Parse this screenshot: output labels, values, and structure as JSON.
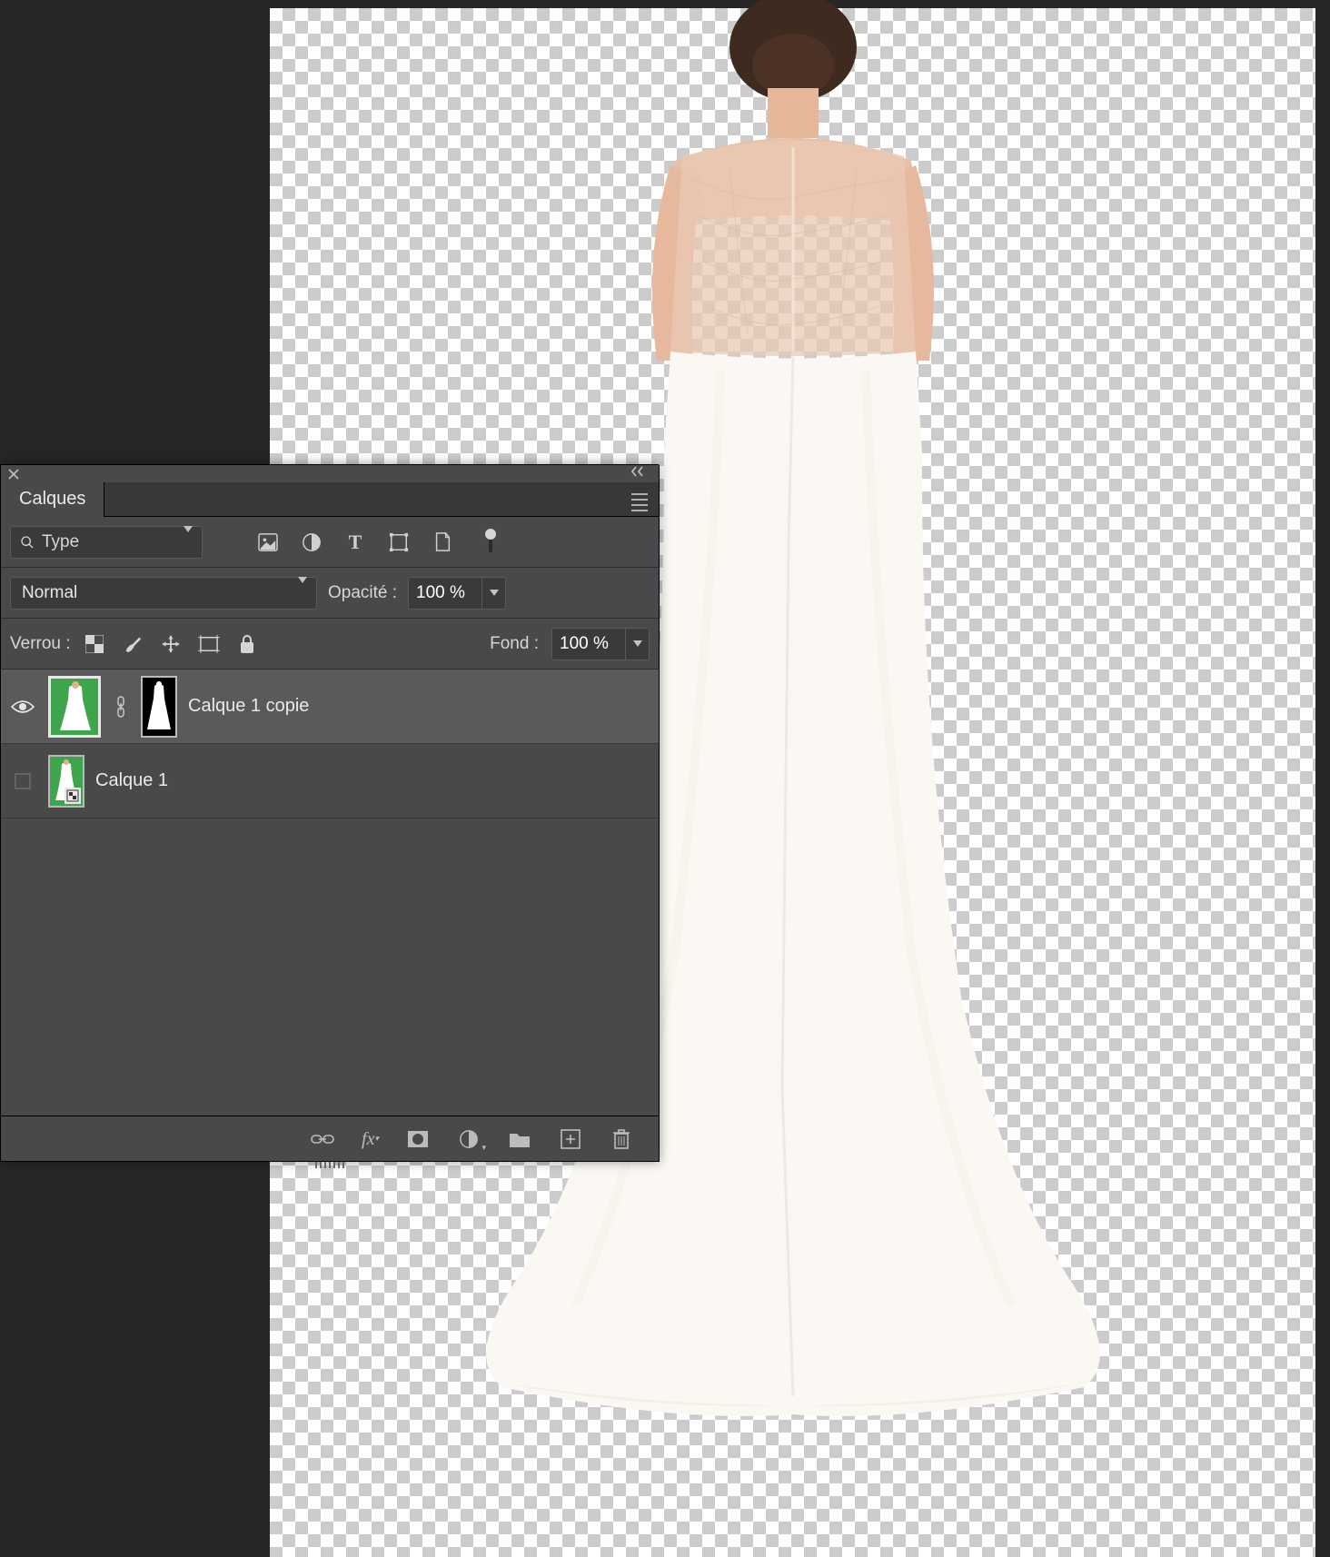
{
  "panel": {
    "tab_label": "Calques",
    "filter": {
      "search_label": "Type"
    },
    "blend": {
      "mode": "Normal",
      "opacity_label": "Opacité :",
      "opacity_value": "100 %"
    },
    "lock": {
      "label": "Verrou :",
      "fill_label": "Fond :",
      "fill_value": "100 %"
    },
    "layers": [
      {
        "name": "Calque 1 copie",
        "visible": true,
        "has_mask": true,
        "selected": true,
        "smart": false,
        "thumb_bg": "green",
        "linked": true
      },
      {
        "name": "Calque 1",
        "visible": false,
        "has_mask": false,
        "selected": false,
        "smart": true,
        "thumb_bg": "green",
        "linked": false
      }
    ],
    "footer_icons": [
      "link-icon",
      "fx-icon",
      "mask-add-icon",
      "adjustment-icon",
      "group-icon",
      "new-layer-icon",
      "trash-icon"
    ]
  },
  "canvas": {
    "subject": "wedding-dress-back",
    "background": "transparent"
  }
}
